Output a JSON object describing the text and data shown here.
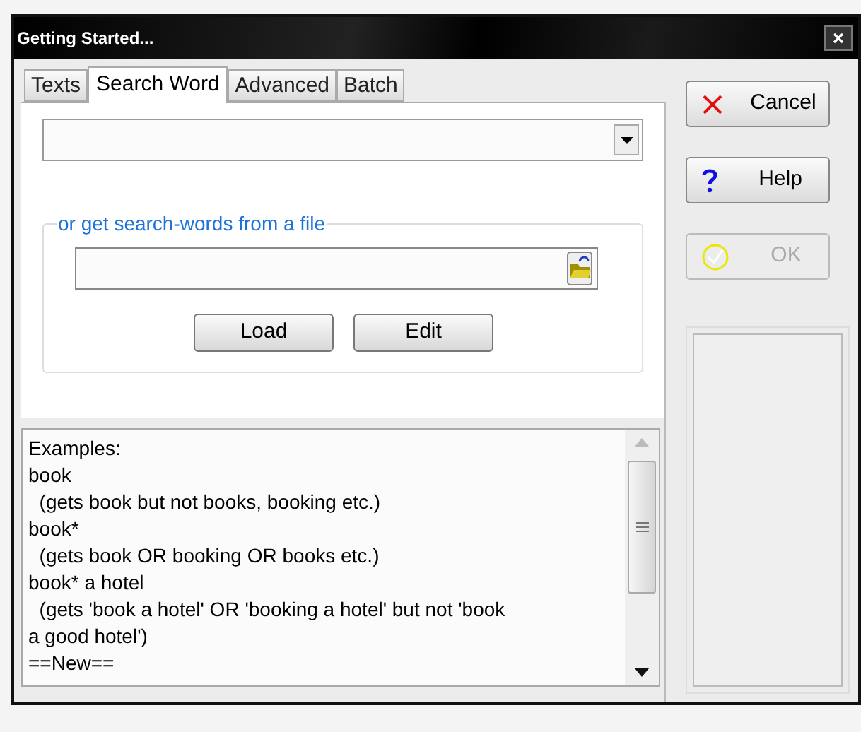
{
  "window": {
    "title": "Getting Started..."
  },
  "tabs": [
    {
      "label": "Texts",
      "selected": false
    },
    {
      "label": "Search Word",
      "selected": true
    },
    {
      "label": "Advanced",
      "selected": false
    },
    {
      "label": "Batch",
      "selected": false
    }
  ],
  "file_group": {
    "legend": "or get search-words from a file",
    "buttons": [
      {
        "label": "Load"
      },
      {
        "label": "Edit"
      }
    ]
  },
  "examples": [
    "Examples:",
    "book",
    "  (gets book but not books, booking etc.)",
    "book*",
    "  (gets book OR booking OR books etc.)",
    "book* a hotel",
    "  (gets 'book a hotel' OR 'booking a hotel' but not 'book",
    "a good hotel')",
    "==New=="
  ],
  "side_buttons": [
    {
      "kind": "cancel",
      "label": "Cancel",
      "disabled": false
    },
    {
      "kind": "help",
      "label": "Help",
      "disabled": false
    },
    {
      "kind": "ok",
      "label": "OK",
      "disabled": true
    }
  ]
}
